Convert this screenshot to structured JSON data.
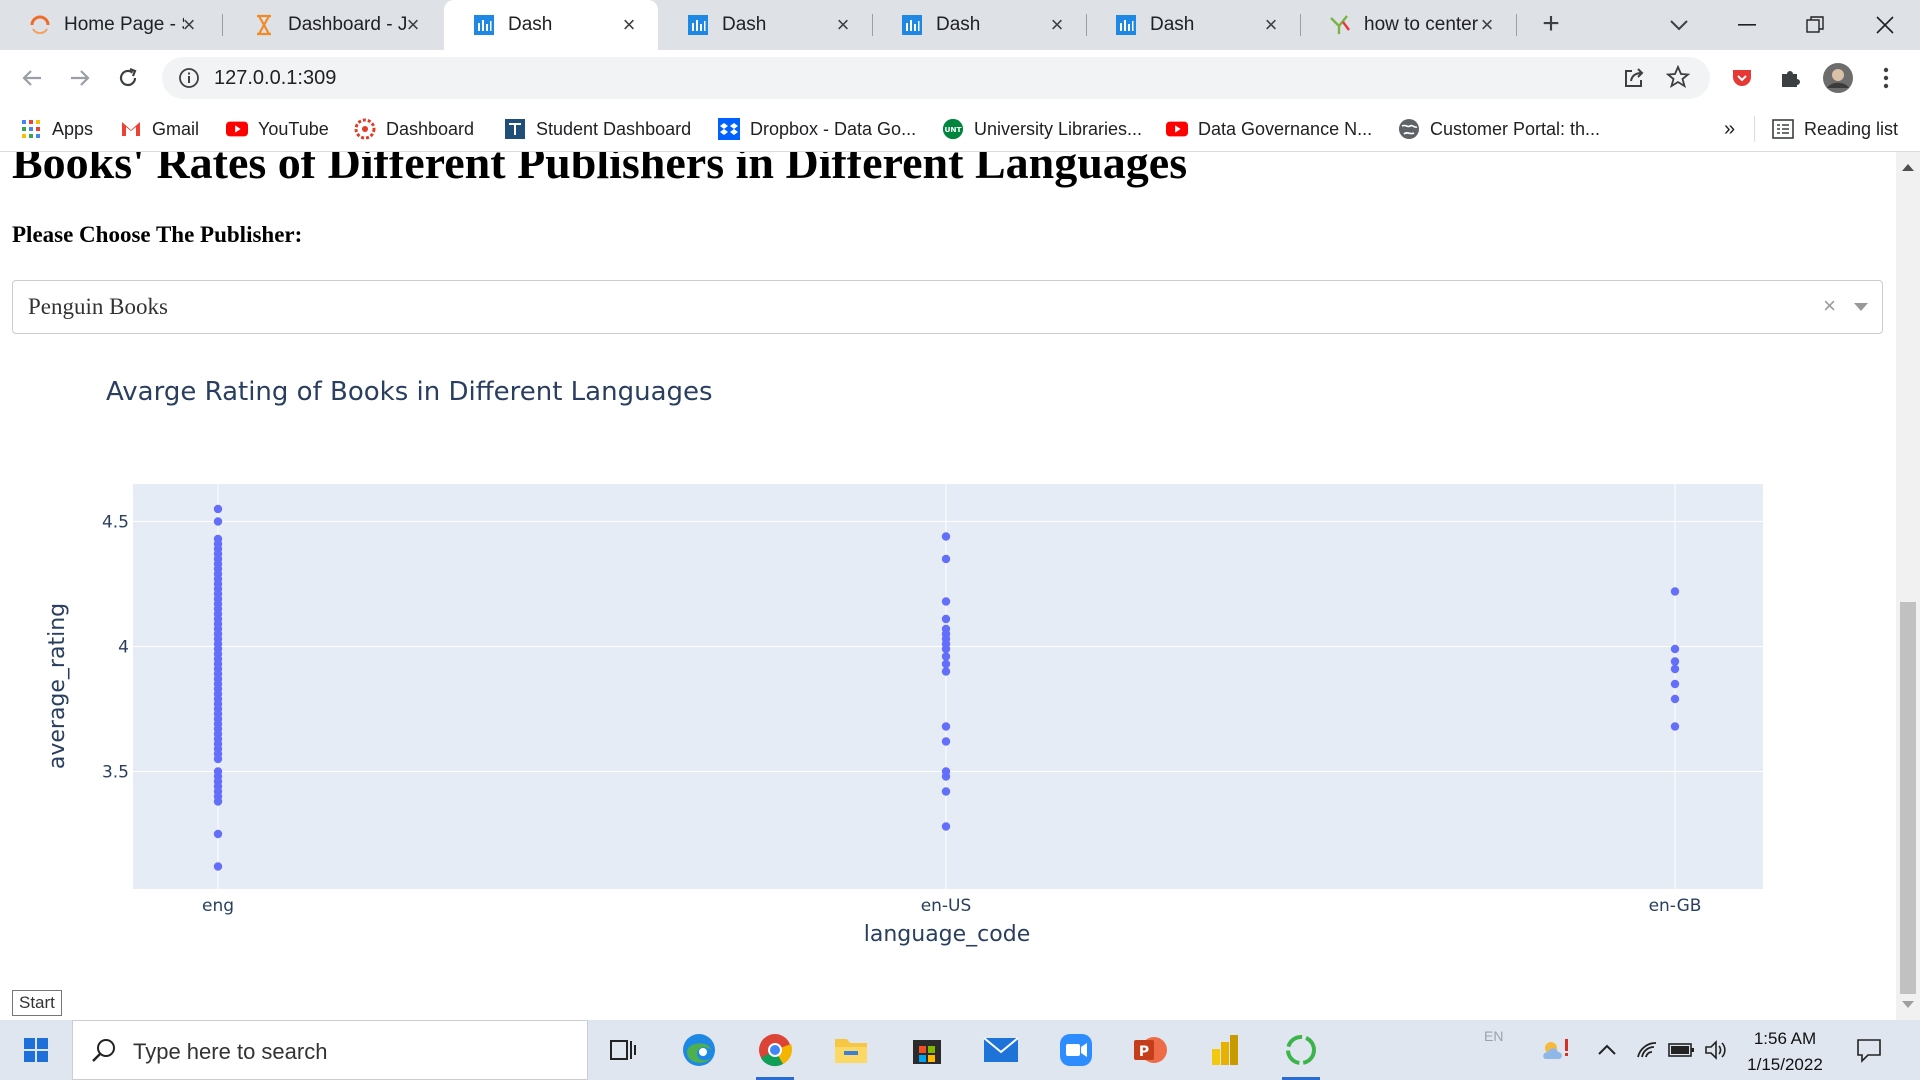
{
  "browser": {
    "tabs": [
      {
        "title": "Home Page - S",
        "icon": "loader-arc-icon",
        "active": false
      },
      {
        "title": "Dashboard - Ju",
        "icon": "hourglass-icon",
        "active": false
      },
      {
        "title": "Dash",
        "icon": "dash-app-icon",
        "active": true
      },
      {
        "title": "Dash",
        "icon": "dash-app-icon",
        "active": false
      },
      {
        "title": "Dash",
        "icon": "dash-app-icon",
        "active": false
      },
      {
        "title": "Dash",
        "icon": "dash-app-icon",
        "active": false
      },
      {
        "title": "how to center",
        "icon": "yahoo-search-icon",
        "active": false
      }
    ],
    "url": "127.0.0.1:309",
    "bookmarks": [
      {
        "label": "Apps",
        "icon": "apps-grid-icon"
      },
      {
        "label": "Gmail",
        "icon": "gmail-icon"
      },
      {
        "label": "YouTube",
        "icon": "youtube-icon"
      },
      {
        "label": "Dashboard",
        "icon": "canvas-icon"
      },
      {
        "label": "Student Dashboard",
        "icon": "student-dashboard-icon"
      },
      {
        "label": "Dropbox - Data Go...",
        "icon": "dropbox-icon"
      },
      {
        "label": "University Libraries...",
        "icon": "unt-icon"
      },
      {
        "label": "Data Governance N...",
        "icon": "youtube-icon"
      },
      {
        "label": "Customer Portal: th...",
        "icon": "globe-icon"
      }
    ],
    "bookmarks_overflow": "»",
    "reading_list": "Reading list"
  },
  "page": {
    "heading": "Books' Rates of Different Publishers in Different Languages",
    "prompt": "Please Choose The Publisher:",
    "dropdown": {
      "value": "Penguin Books",
      "clear_glyph": "×"
    }
  },
  "chart_data": {
    "type": "scatter",
    "title": "Avarge Rating of Books in Different Languages",
    "xlabel": "language_code",
    "ylabel": "average_rating",
    "categories": [
      "eng",
      "en-US",
      "en-GB"
    ],
    "yticks": [
      "3.5",
      "4",
      "4.5"
    ],
    "ylim": [
      3.03,
      4.65
    ],
    "marker_color": "#636efa",
    "plot_bg": "#e5ecf6",
    "grid": true,
    "series": [
      {
        "x": "eng",
        "values": [
          4.55,
          4.5,
          4.43,
          4.41,
          4.39,
          4.37,
          4.35,
          4.33,
          4.31,
          4.29,
          4.27,
          4.25,
          4.23,
          4.21,
          4.19,
          4.17,
          4.15,
          4.13,
          4.11,
          4.09,
          4.07,
          4.05,
          4.03,
          4.01,
          3.99,
          3.97,
          3.95,
          3.93,
          3.91,
          3.89,
          3.87,
          3.85,
          3.83,
          3.81,
          3.79,
          3.77,
          3.75,
          3.73,
          3.71,
          3.69,
          3.67,
          3.65,
          3.63,
          3.61,
          3.59,
          3.57,
          3.55,
          3.5,
          3.48,
          3.46,
          3.44,
          3.42,
          3.4,
          3.38,
          3.25,
          3.12
        ]
      },
      {
        "x": "en-US",
        "values": [
          4.44,
          4.35,
          4.18,
          4.11,
          4.07,
          4.05,
          4.03,
          4.01,
          3.99,
          3.96,
          3.93,
          3.9,
          3.68,
          3.62,
          3.5,
          3.48,
          3.42,
          3.28
        ]
      },
      {
        "x": "en-GB",
        "values": [
          4.22,
          3.99,
          3.94,
          3.91,
          3.85,
          3.79,
          3.68
        ]
      }
    ]
  },
  "tooltip": "Start",
  "taskbar": {
    "search_placeholder": "Type here to search",
    "apps": [
      "task-view-icon",
      "edge-icon",
      "chrome-icon",
      "file-explorer-icon",
      "store-icon",
      "mail-icon",
      "zoom-icon",
      "powerpoint-icon",
      "power-bi-icon",
      "circle-app-icon"
    ],
    "lang": "EN",
    "time": "1:56 AM",
    "date": "1/15/2022"
  }
}
